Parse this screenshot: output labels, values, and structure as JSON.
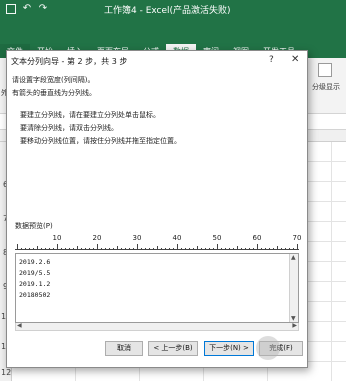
{
  "excel": {
    "window_title": "工作簿4 - Excel(产品激活失败)",
    "tabs": [
      {
        "label": "文件"
      },
      {
        "label": "开始"
      },
      {
        "label": "插入"
      },
      {
        "label": "页面布局"
      },
      {
        "label": "公式"
      },
      {
        "label": "数据"
      },
      {
        "label": "审阅"
      },
      {
        "label": "视图"
      },
      {
        "label": "开发工具"
      }
    ],
    "active_tab": "数据",
    "ribbon_right_label": "分级显示",
    "left_label": "外部",
    "row_numbers": [
      "6",
      "7",
      "8",
      "9",
      "10",
      "11",
      "12"
    ]
  },
  "dialog": {
    "title": "文本分列向导 - 第 2 步，共 3 步",
    "help_label": "?",
    "close_label": "✕",
    "instructions": [
      "请设置字段宽度(列间隔)。",
      "有箭头的垂直线为分列线。",
      "要建立分列线，请在要建立分列处单击鼠标。",
      "要清除分列线，请双击分列线。",
      "要移动分列线位置，请按住分列线并拖至指定位置。"
    ],
    "preview_label": "数据预览(P)",
    "ruler_labels": [
      "10",
      "20",
      "30",
      "40",
      "50",
      "60",
      "70"
    ],
    "preview_lines": [
      "2019.2.6",
      "2019/5.5",
      "2019.1.2",
      "20180502"
    ],
    "buttons": {
      "cancel": "取消",
      "back": "< 上一步(B)",
      "next": "下一步(N) >",
      "finish": "完成(F)"
    }
  },
  "colors": {
    "excel_green": "#217346",
    "button_focus": "#0078d7"
  }
}
